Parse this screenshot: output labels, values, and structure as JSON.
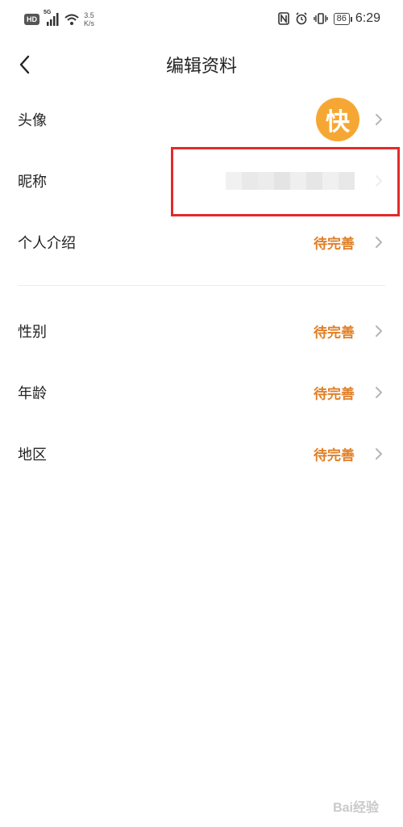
{
  "status_bar": {
    "network_badge": "HD",
    "network_gen": "5G",
    "speed_value": "3.5",
    "speed_unit": "K/s",
    "battery": "86",
    "time": "6:29"
  },
  "header": {
    "title": "编辑资料"
  },
  "profile": {
    "avatar_row": {
      "label": "头像",
      "avatar_text": "快"
    },
    "nickname_row": {
      "label": "昵称"
    },
    "intro_row": {
      "label": "个人介绍",
      "value": "待完善"
    }
  },
  "details": {
    "gender_row": {
      "label": "性别",
      "value": "待完善"
    },
    "age_row": {
      "label": "年龄",
      "value": "待完善"
    },
    "region_row": {
      "label": "地区",
      "value": "待完善"
    }
  },
  "watermark": "Bai经验",
  "colors": {
    "accent": "#e07f26",
    "avatar_bg": "#f6a733",
    "highlight": "#e32a2a",
    "chevron": "#b5b5b5"
  }
}
